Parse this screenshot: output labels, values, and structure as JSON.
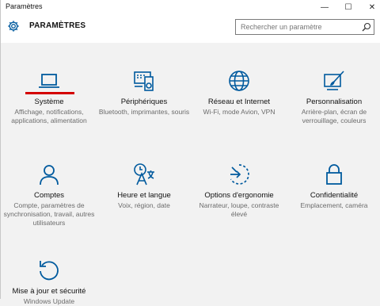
{
  "window": {
    "title": "Paramètres",
    "controls": {
      "minimize": "—",
      "maximize": "☐",
      "close": "✕"
    }
  },
  "header": {
    "title": "PARAMÈTRES",
    "search_placeholder": "Rechercher un paramètre",
    "icons": {
      "settings": "gear-icon",
      "search": "search-icon"
    }
  },
  "accent_color": "#005a9e",
  "highlight_color": "#d40000",
  "categories": [
    {
      "label": "Système",
      "desc": "Affichage, notifications, applications, alimentation",
      "icon": "laptop-icon"
    },
    {
      "label": "Périphériques",
      "desc": "Bluetooth, imprimantes, souris",
      "icon": "devices-icon"
    },
    {
      "label": "Réseau et Internet",
      "desc": "Wi-Fi, mode Avion, VPN",
      "icon": "globe-icon"
    },
    {
      "label": "Personnalisation",
      "desc": "Arrière-plan, écran de verrouillage, couleurs",
      "icon": "paint-icon"
    },
    {
      "label": "Comptes",
      "desc": "Compte, paramètres de synchronisation, travail, autres utilisateurs",
      "icon": "person-icon"
    },
    {
      "label": "Heure et langue",
      "desc": "Voix, région, date",
      "icon": "time-language-icon"
    },
    {
      "label": "Options d'ergonomie",
      "desc": "Narrateur, loupe, contraste élevé",
      "icon": "ease-of-access-icon"
    },
    {
      "label": "Confidentialité",
      "desc": "Emplacement, caméra",
      "icon": "lock-icon"
    },
    {
      "label": "Mise à jour et sécurité",
      "desc": "Windows Update",
      "icon": "update-icon"
    }
  ]
}
